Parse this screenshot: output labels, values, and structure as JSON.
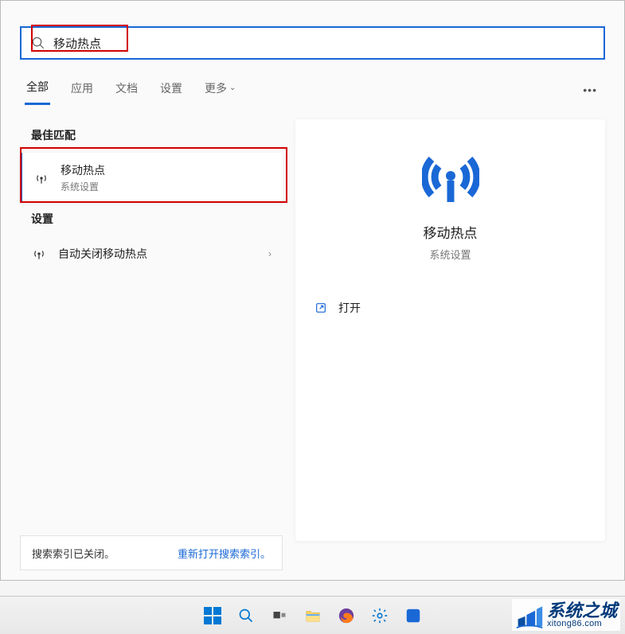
{
  "search": {
    "value": "移动热点",
    "placeholder": ""
  },
  "tabs": {
    "all": "全部",
    "apps": "应用",
    "docs": "文档",
    "settings": "设置",
    "more": "更多"
  },
  "sections": {
    "best_match": "最佳匹配",
    "settings": "设置"
  },
  "results": {
    "best": {
      "title": "移动热点",
      "subtitle": "系统设置"
    },
    "setting1": {
      "title": "自动关闭移动热点"
    }
  },
  "preview": {
    "title": "移动热点",
    "subtitle": "系统设置",
    "open_label": "打开"
  },
  "index_bar": {
    "status": "搜索索引已关闭。",
    "link": "重新打开搜索索引。"
  },
  "watermark": {
    "main": "系统之城",
    "sub": "xitong86.com"
  }
}
